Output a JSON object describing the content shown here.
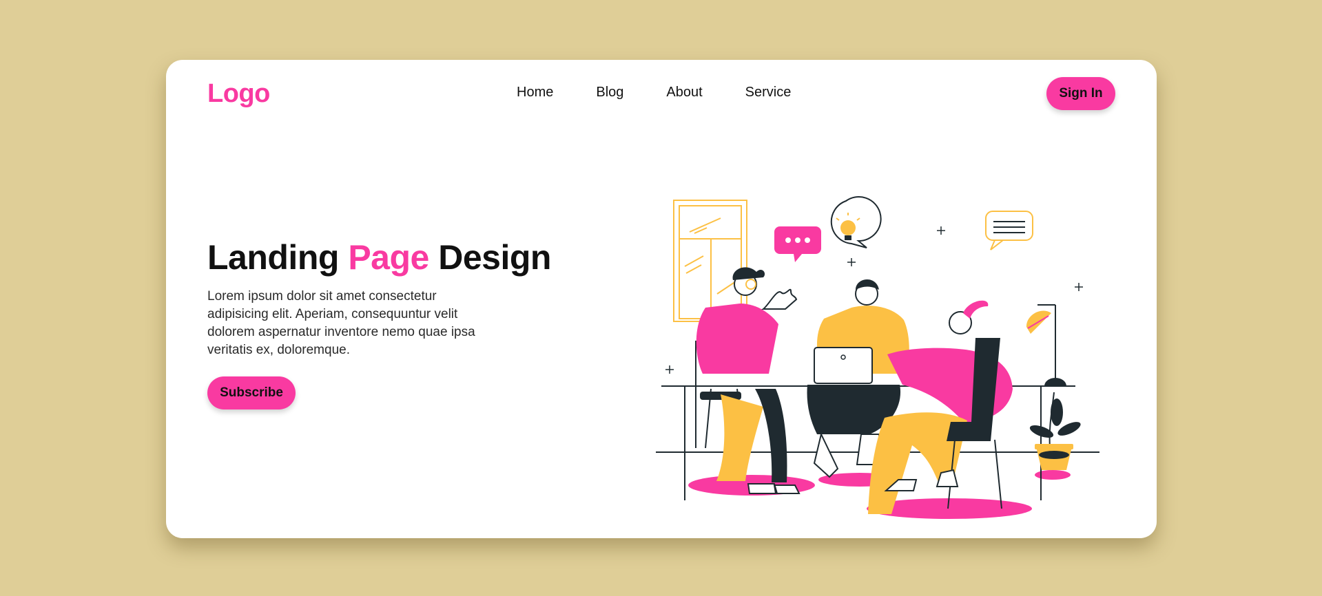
{
  "header": {
    "logo": "Logo",
    "nav": [
      "Home",
      "Blog",
      "About",
      "Service"
    ],
    "signin_label": "Sign In"
  },
  "hero": {
    "title_part1": "Landing ",
    "title_accent": "Page",
    "title_part2": " Design",
    "description": "Lorem ipsum dolor sit amet consectetur adipisicing elit. Aperiam, consequuntur velit dolorem aspernatur inventore nemo quae ipsa veritatis ex, doloremque.",
    "subscribe_label": "Subscribe"
  },
  "colors": {
    "background": "#dfce97",
    "card": "#ffffff",
    "accent": "#f93aa1",
    "yellow": "#fcc044",
    "dark": "#1f2a30"
  },
  "icons": [
    "chat-dots-icon",
    "lightbulb-icon",
    "message-lines-icon",
    "sparkle-icon"
  ]
}
